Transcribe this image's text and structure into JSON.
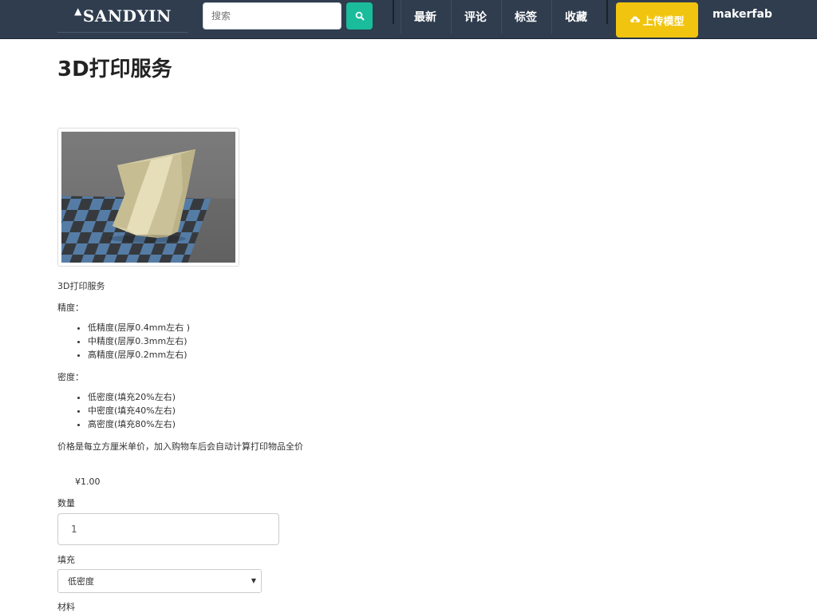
{
  "nav": {
    "logo": "SANDYIN",
    "search_placeholder": "搜索",
    "items": [
      "最新",
      "评论",
      "标签",
      "收藏"
    ],
    "upload_label": "上传模型",
    "user": "makerfab"
  },
  "page": {
    "title": "3D打印服务",
    "image_alt": "3D打印服务",
    "description": "3D打印服务",
    "precision_heading": "精度：",
    "precision_options": [
      "低精度(层厚0.4mm左右 )",
      "中精度(层厚0.3mm左右)",
      "高精度(层厚0.2mm左右)"
    ],
    "density_heading": "密度：",
    "density_options": [
      "低密度(填充20%左右)",
      "中密度(填充40%左右)",
      "高密度(填充80%左右)"
    ],
    "price_note": "价格是每立方厘米单价，加入购物车后会自动计算打印物品全价",
    "price": "¥1.00",
    "quantity_label": "数量",
    "quantity_value": "1",
    "fill_label": "填充",
    "fill_selected": "低密度",
    "material_label": "材料"
  },
  "colors": {
    "nav_bg": "#2f3d4e",
    "search_button": "#1abc9c",
    "upload_button": "#f1c40f"
  },
  "icons": {
    "search": "search-icon",
    "upload": "cloud-upload-icon",
    "logo_arrow": "up-arrow-icon",
    "select": "caret-down-icon"
  }
}
